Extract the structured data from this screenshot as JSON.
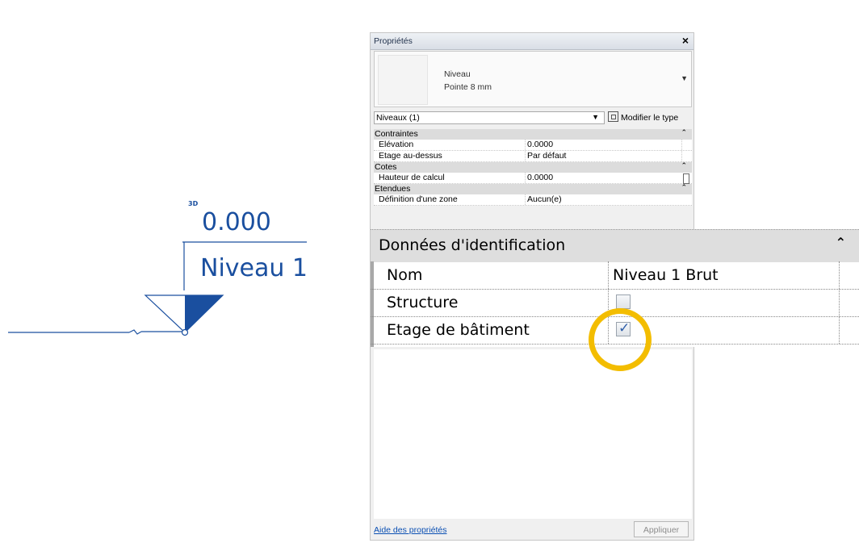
{
  "level_marker": {
    "badge": "3D",
    "elevation": "0.000",
    "name": "Niveau 1",
    "color": "#1a4f9f"
  },
  "properties": {
    "title": "Propriétés",
    "close_glyph": "×",
    "type_family": "Niveau",
    "type_name": "Pointe 8 mm",
    "filter_value": "Niveaux (1)",
    "edit_type_label": "Modifier le type",
    "groups": [
      {
        "label": "Contraintes",
        "rows": [
          {
            "name": "Elévation",
            "value": "0.0000"
          },
          {
            "name": "Etage au-dessus",
            "value": "Par défaut"
          }
        ]
      },
      {
        "label": "Cotes",
        "rows": [
          {
            "name": "Hauteur de calcul",
            "value": "0.0000"
          }
        ]
      },
      {
        "label": "Etendues",
        "rows": [
          {
            "name": "Définition d'une zone",
            "value": "Aucun(e)"
          }
        ]
      }
    ],
    "help_label": "Aide des propriétés",
    "apply_label": "Appliquer"
  },
  "zoom": {
    "group_label": "Données d'identification",
    "rows": [
      {
        "name": "Nom",
        "value": "Niveau 1 Brut"
      },
      {
        "name": "Structure",
        "checked": false
      },
      {
        "name": "Etage de bâtiment",
        "checked": true
      }
    ],
    "highlight_color": "#f3bd00"
  }
}
